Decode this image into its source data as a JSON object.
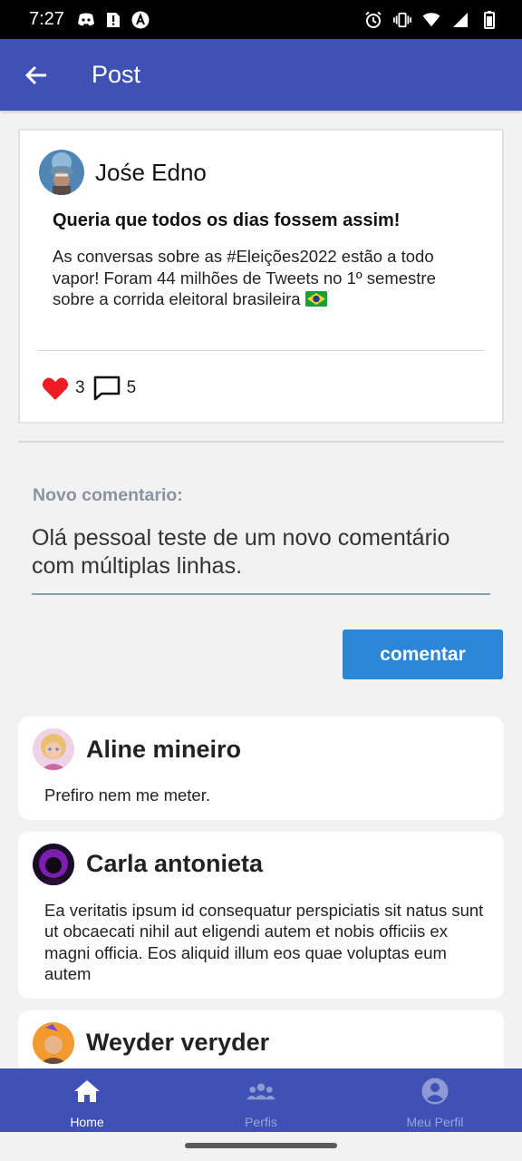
{
  "status_bar": {
    "time": "7:27",
    "left_icons": [
      "discord-icon",
      "alert-icon",
      "app-a-icon"
    ],
    "right_icons": [
      "alarm-icon",
      "vibrate-icon",
      "wifi-icon",
      "signal-icon",
      "battery-icon"
    ]
  },
  "app_bar": {
    "title": "Post",
    "background": "#3f51b5"
  },
  "post": {
    "author": "Jośe Edno",
    "title": "Queria que todos os dias fossem assim!",
    "body": "As conversas sobre as #Eleições2022 estão a todo vapor! Foram 44 milhões de Tweets no 1º semestre sobre a corrida eleitoral brasileira",
    "likes": "3",
    "comments": "5"
  },
  "comment_form": {
    "label": "Novo comentario:",
    "value": "Olá pessoal teste de um novo comentário com múltiplas linhas.",
    "submit_label": "comentar",
    "button_color": "#2a86d6"
  },
  "comments": [
    {
      "author": "Aline mineiro",
      "text": "Prefiro nem me meter."
    },
    {
      "author": "Carla antonieta",
      "text": "Ea veritatis ipsum id consequatur perspiciatis sit natus sunt ut obcaecati nihil aut eligendi autem et nobis officiis ex magni officia. Eos aliquid illum eos quae voluptas eum autem"
    },
    {
      "author": "Weyder veryder",
      "text": ""
    }
  ],
  "bottom_nav": {
    "items": [
      {
        "label": "Home",
        "icon": "home-icon",
        "active": true
      },
      {
        "label": "Perfis",
        "icon": "people-icon",
        "active": false
      },
      {
        "label": "Meu Perfil",
        "icon": "account-circle-icon",
        "active": false
      }
    ]
  }
}
